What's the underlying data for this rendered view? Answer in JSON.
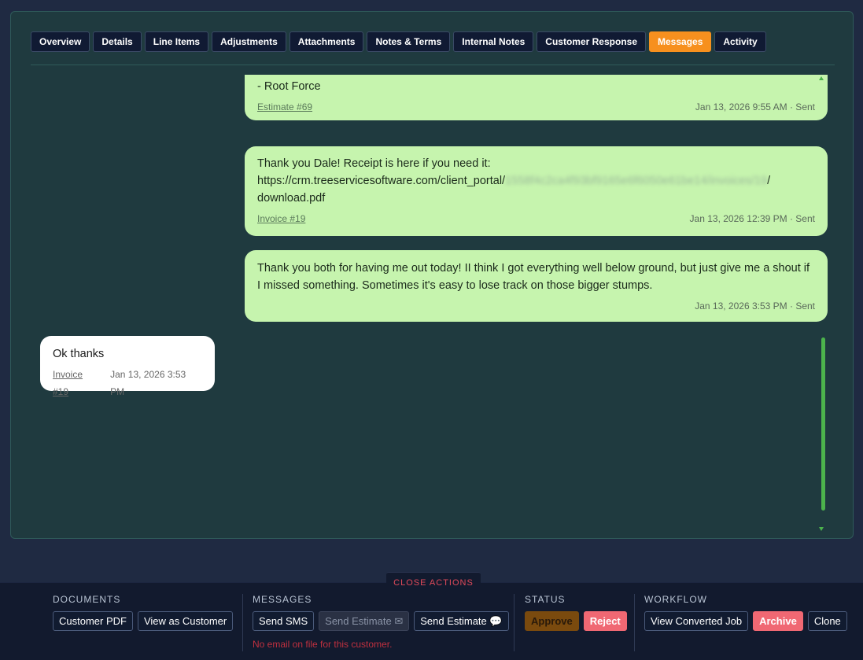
{
  "tabs": [
    {
      "label": "Overview"
    },
    {
      "label": "Details"
    },
    {
      "label": "Line Items"
    },
    {
      "label": "Adjustments"
    },
    {
      "label": "Attachments"
    },
    {
      "label": "Notes & Terms"
    },
    {
      "label": "Internal Notes"
    },
    {
      "label": "Customer Response"
    },
    {
      "label": "Messages",
      "active": true
    },
    {
      "label": "Activity"
    }
  ],
  "messages": [
    {
      "text": "- Root Force",
      "link": "Estimate #69",
      "time": "Jan 13, 2026 9:55 AM · Sent"
    },
    {
      "text_line1": "Thank you Dale! Receipt  is here if you need it:",
      "url_prefix": "https://crm.treeservicesoftware.com/client_portal/",
      "url_blurred": "1558f4c2ca4f93bf9165e6f6050e61be14/invoices/19",
      "url_suffix": "/",
      "text_line3": "download.pdf",
      "link": "Invoice #19",
      "time": "Jan 13, 2026 12:39 PM · Sent"
    },
    {
      "text": "Thank you both for having me out today! II think I got everything well below ground, but just give me a shout if I missed something.  Sometimes it's easy to lose track on those bigger stumps.",
      "time": "Jan 13, 2026 3:53 PM · Sent"
    },
    {
      "text": "Ok thanks",
      "link": "Invoice #19",
      "time": "Jan 13, 2026 3:53 PM"
    }
  ],
  "actions": {
    "close_label": "CLOSE ACTIONS",
    "documents": {
      "title": "DOCUMENTS",
      "customer_pdf": "Customer PDF",
      "view_as_customer": "View as Customer"
    },
    "messages": {
      "title": "MESSAGES",
      "send_sms": "Send SMS",
      "send_estimate_email": "Send Estimate",
      "send_estimate_sms": "Send Estimate",
      "warning": "No email on file for this customer."
    },
    "status": {
      "title": "STATUS",
      "approve": "Approve",
      "reject": "Reject"
    },
    "workflow": {
      "title": "WORKFLOW",
      "view_converted_job": "View Converted Job",
      "archive": "Archive",
      "clone": "Clone"
    }
  },
  "colors": {
    "accent": "#f7901e",
    "sent_bubble": "#c6f4ae",
    "danger": "#f06873"
  }
}
